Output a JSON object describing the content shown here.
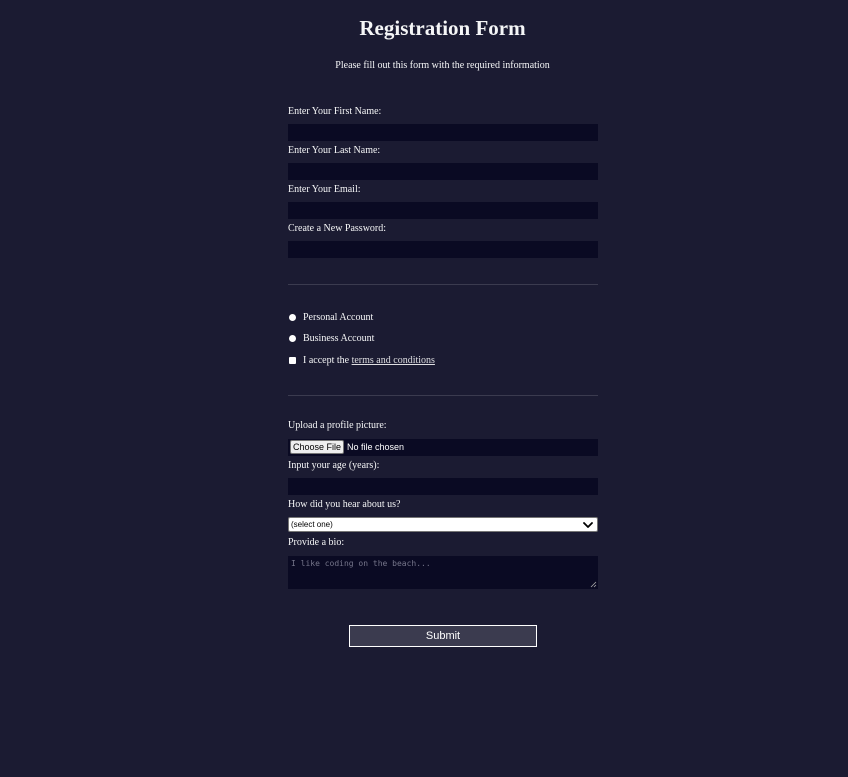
{
  "header": {
    "title": "Registration Form",
    "subtitle": "Please fill out this form with the required information"
  },
  "fields": {
    "first_name": {
      "label": "Enter Your First Name:",
      "value": ""
    },
    "last_name": {
      "label": "Enter Your Last Name:",
      "value": ""
    },
    "email": {
      "label": "Enter Your Email:",
      "value": ""
    },
    "password": {
      "label": "Create a New Password:",
      "value": ""
    }
  },
  "account_type": {
    "options": [
      "Personal Account",
      "Business Account"
    ]
  },
  "terms": {
    "prefix": "I accept the ",
    "link_text": "terms and conditions"
  },
  "profile_picture": {
    "label": "Upload a profile picture:",
    "button_label": "Choose File",
    "status": "No file chosen"
  },
  "age": {
    "label": "Input your age (years):",
    "value": ""
  },
  "referrer": {
    "label": "How did you hear about us?",
    "selected": "(select one)"
  },
  "bio": {
    "label": "Provide a bio:",
    "placeholder": "I like coding on the beach..."
  },
  "submit": {
    "label": "Submit"
  },
  "colors": {
    "background": "#1b1b32",
    "input_background": "#0a0a23",
    "text": "#f5f6f7",
    "separator": "#3b3b4f",
    "button_background": "#3b3b4f"
  },
  "icons": {
    "select_arrow": "chevron-down-icon",
    "textarea_grip": "resize-grip-icon"
  }
}
